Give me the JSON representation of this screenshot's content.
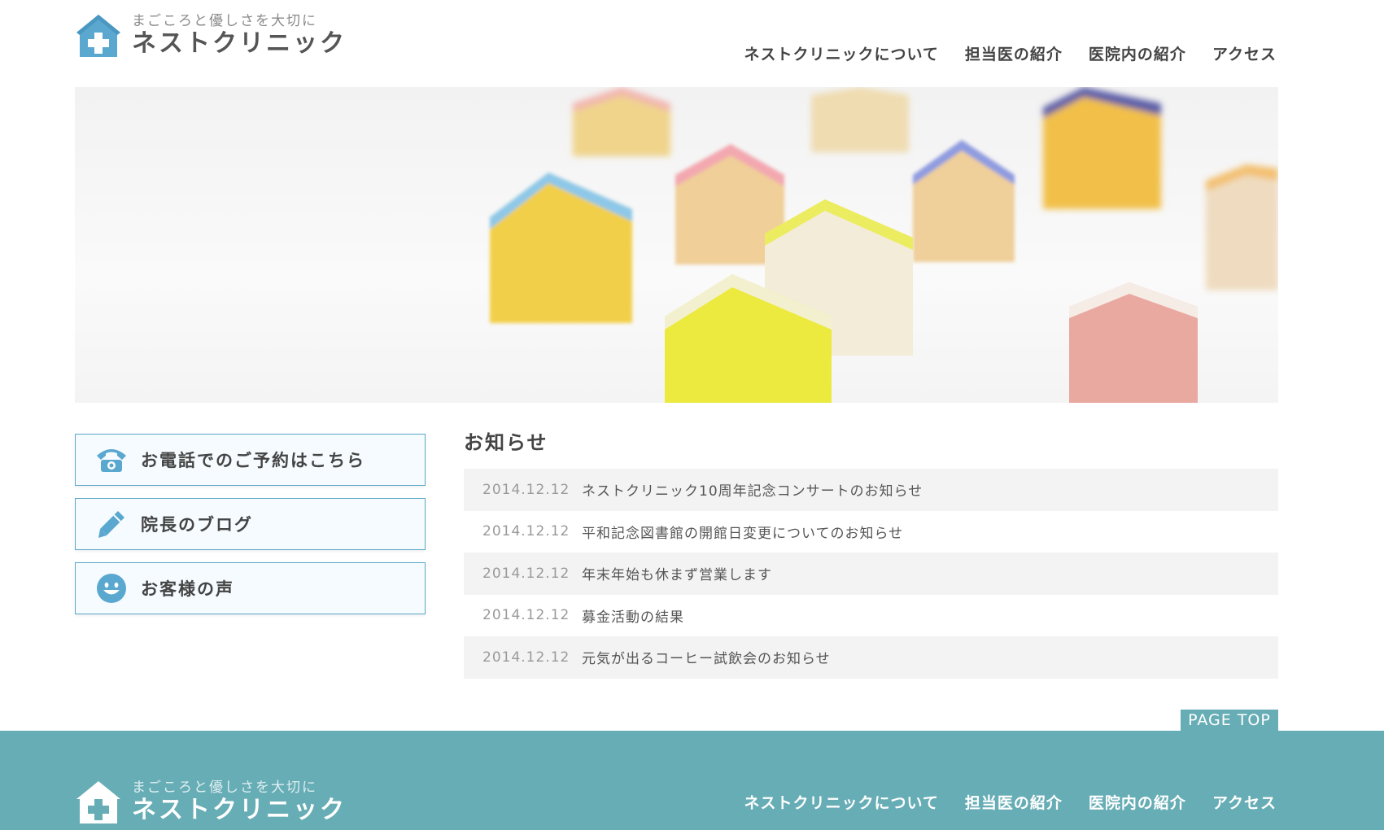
{
  "header": {
    "logo": {
      "tagline": "まごころと優しさを大切に",
      "name": "ネストクリニック"
    },
    "nav": [
      {
        "label": "ネストクリニックについて"
      },
      {
        "label": "担当医の紹介"
      },
      {
        "label": "医院内の紹介"
      },
      {
        "label": "アクセス"
      }
    ]
  },
  "side_menu": [
    {
      "label": "お電話でのご予約はこちら",
      "icon": "phone-icon"
    },
    {
      "label": "院長のブログ",
      "icon": "pencil-icon"
    },
    {
      "label": "お客様の声",
      "icon": "smiley-icon"
    }
  ],
  "news": {
    "title": "お知らせ",
    "items": [
      {
        "date": "2014.12.12",
        "text": "ネストクリニック10周年記念コンサートのお知らせ"
      },
      {
        "date": "2014.12.12",
        "text": "平和記念図書館の開館日変更についてのお知らせ"
      },
      {
        "date": "2014.12.12",
        "text": "年末年始も休まず営業します"
      },
      {
        "date": "2014.12.12",
        "text": "募金活動の結果"
      },
      {
        "date": "2014.12.12",
        "text": "元気が出るコーヒー試飲会のお知らせ"
      }
    ]
  },
  "page_top": "PAGE TOP",
  "footer": {
    "logo": {
      "tagline": "まごころと優しさを大切に",
      "name": "ネストクリニック"
    },
    "nav": [
      {
        "label": "ネストクリニックについて"
      },
      {
        "label": "担当医の紹介"
      },
      {
        "label": "医院内の紹介"
      },
      {
        "label": "アクセス"
      }
    ]
  },
  "colors": {
    "accent": "#5aa8c8",
    "footer_bg": "#67adb5",
    "row_alt": "#f3f3f3"
  }
}
